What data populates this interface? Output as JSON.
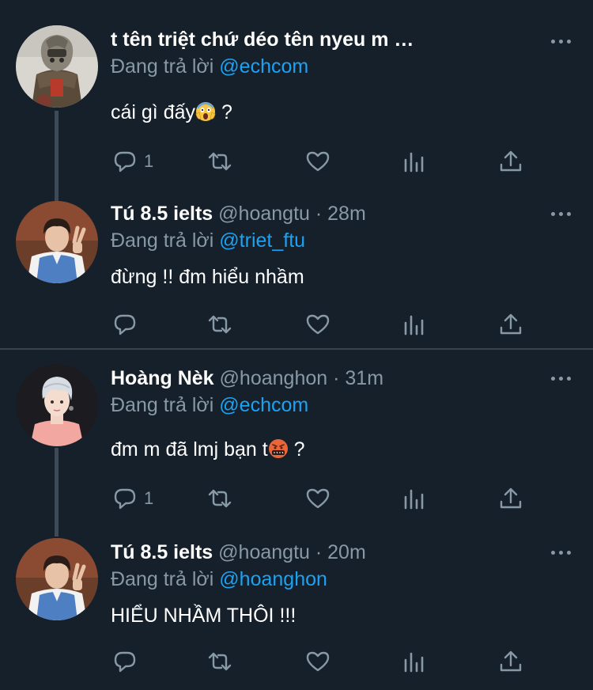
{
  "tweets": [
    {
      "name": "t tên triệt chứ déo tên nyeu m …",
      "handle": "",
      "time": "",
      "reply_label": "Đang trả lời",
      "reply_mention": "@echcom",
      "text": "cái gì đấy",
      "text_after": " ?",
      "emoji": "face-screaming-in-fear-emoji",
      "reply_count": "1",
      "avatar": "photo-person-with-bag-on-head"
    },
    {
      "name": "Tú 8.5 ielts",
      "handle": "@hoangtu",
      "time": "· 28m",
      "reply_label": "Đang trả lời",
      "reply_mention": "@triet_ftu",
      "text": "đừng !! đm hiểu nhầm",
      "reply_count": "",
      "avatar": "photo-person-blue-vest-peace-sign"
    },
    {
      "name": "Hoàng Nèk",
      "handle": "@hoanghon",
      "time": "· 31m",
      "reply_label": "Đang trả lời",
      "reply_mention": "@echcom",
      "text": "đm m đã lmj bạn t",
      "text_after": " ?",
      "emoji": "face-with-symbols-on-mouth-emoji",
      "reply_count": "1",
      "avatar": "photo-person-silver-hair-pink-shirt"
    },
    {
      "name": "Tú 8.5 ielts",
      "handle": "@hoangtu",
      "time": "· 20m",
      "reply_label": "Đang trả lời",
      "reply_mention": "@hoanghon",
      "text": "HIỂU NHẦM THÔI !!!",
      "reply_count": "",
      "avatar": "photo-person-blue-vest-peace-sign"
    }
  ],
  "icons": [
    "reply-icon",
    "retweet-icon",
    "like-icon",
    "analytics-icon",
    "share-icon",
    "more-icon"
  ],
  "colors": {
    "background": "#15202b",
    "secondary_text": "#8899a6",
    "mention": "#1da1f2",
    "divider": "#38444d"
  }
}
